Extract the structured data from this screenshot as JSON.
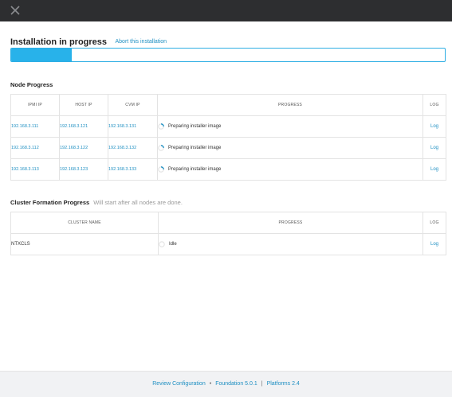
{
  "header": {
    "title": "Installation in progress",
    "abort_label": "Abort this installation",
    "progress": 0.14
  },
  "node_progress": {
    "title": "Node Progress",
    "columns": [
      "IPMI IP",
      "HOST IP",
      "CVM IP",
      "PROGRESS",
      "LOG"
    ],
    "rows": [
      {
        "ipmi": "192.168.3.111",
        "host": "192.168.3.121",
        "cvm": "192.168.3.131",
        "status": "Preparing installer image",
        "log": "Log"
      },
      {
        "ipmi": "192.168.3.112",
        "host": "192.168.3.122",
        "cvm": "192.168.3.132",
        "status": "Preparing installer image",
        "log": "Log"
      },
      {
        "ipmi": "192.168.3.113",
        "host": "192.168.3.123",
        "cvm": "192.168.3.133",
        "status": "Preparing installer image",
        "log": "Log"
      }
    ]
  },
  "cluster_progress": {
    "title": "Cluster Formation Progress",
    "subtitle": "Will start after all nodes are done.",
    "columns": [
      "CLUSTER NAME",
      "PROGRESS",
      "LOG"
    ],
    "rows": [
      {
        "name": "NTXCLS",
        "status": "Idle",
        "log": "Log"
      }
    ]
  },
  "footer": {
    "review_label": "Review Configuration",
    "foundation_label": "Foundation 5.0.1",
    "platforms_label": "Platforms 2.4",
    "bullet": "•",
    "divider": "|"
  },
  "colors": {
    "accent": "#28b2ea",
    "link": "#1e8fc2",
    "topbar": "#2d2e30",
    "footer_bg": "#f1f2f4"
  }
}
